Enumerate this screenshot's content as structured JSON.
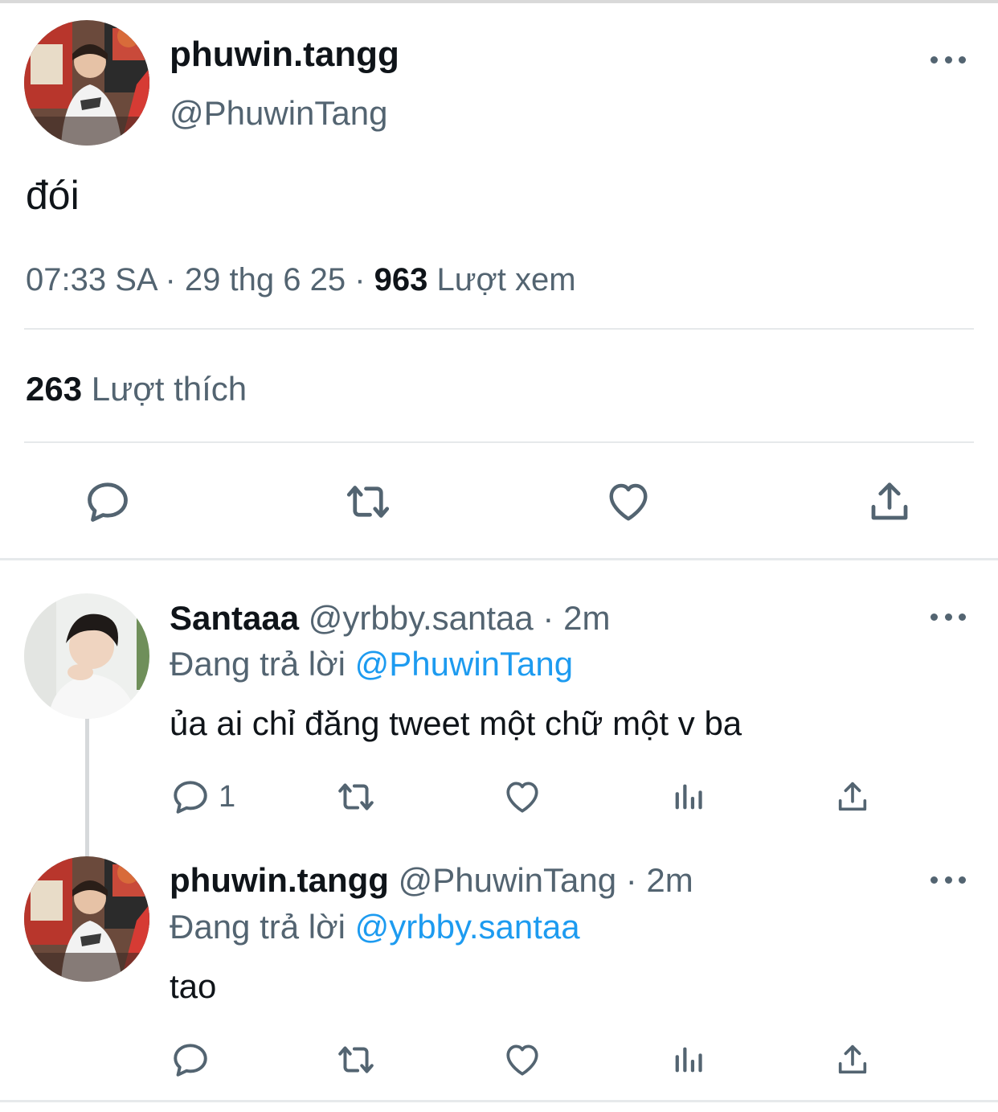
{
  "main_tweet": {
    "display_name": "phuwin.tangg",
    "handle": "@PhuwinTang",
    "text": "đói",
    "time": "07:33 SA",
    "sep1": " · ",
    "date": "29 thg 6 25",
    "sep2": " · ",
    "views_count": "963",
    "views_label": "Lượt xem",
    "likes_count": "263",
    "likes_label": "Lượt thích"
  },
  "replies": [
    {
      "display_name": "Santaaa",
      "handle": "@yrbby.santaa",
      "dot": " · ",
      "age": "2m",
      "replying_prefix": "Đang trả lời ",
      "replying_to": "@PhuwinTang",
      "text": "ủa ai chỉ đăng tweet một chữ một v ba",
      "reply_count": "1"
    },
    {
      "display_name": "phuwin.tangg",
      "handle": "@PhuwinTang",
      "dot": " · ",
      "age": "2m",
      "replying_prefix": "Đang trả lời ",
      "replying_to": "@yrbby.santaa",
      "text": "tao",
      "reply_count": ""
    }
  ],
  "icons": {
    "reply": "speech-bubble-icon",
    "retweet": "retweet-arrows-icon",
    "like": "heart-outline-icon",
    "views": "bar-chart-icon",
    "share": "upload-share-icon",
    "more": "more-dots-icon"
  },
  "colors": {
    "text": "#0f1419",
    "secondary": "#536471",
    "link": "#1d9bf0",
    "divider": "#e6e9eb"
  }
}
